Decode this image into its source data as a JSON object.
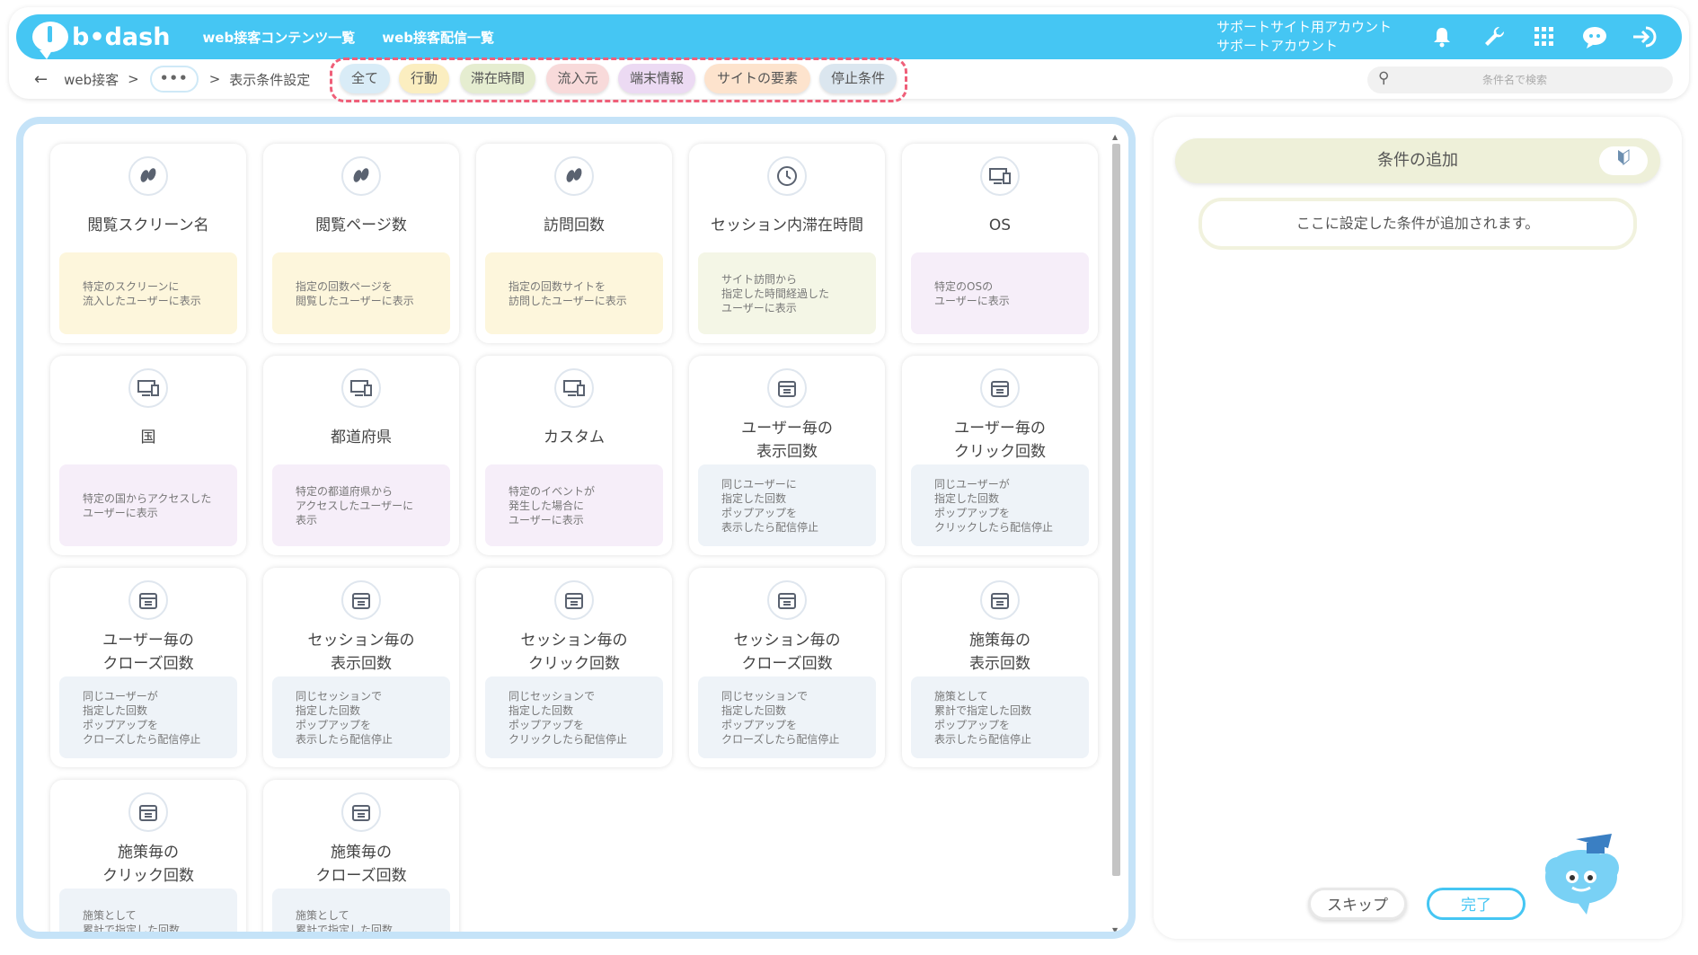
{
  "header": {
    "logo_text": "b•dash",
    "nav": [
      "web接客コンテンツ一覧",
      "web接客配信一覧"
    ],
    "account_line1": "サポートサイト用アカウント",
    "account_line2": "サポートアカウント",
    "icons": [
      "bell-icon",
      "wrench-icon",
      "grid-icon",
      "chat-bot-icon",
      "logout-icon"
    ]
  },
  "breadcrumb": {
    "back": "←",
    "item1": "web接客",
    "sep": ">",
    "dots": "•••",
    "sep2": ">",
    "current": "表示条件設定"
  },
  "tabs": [
    {
      "label": "全て",
      "color": "#d9ecf7"
    },
    {
      "label": "行動",
      "color": "#fbeec0"
    },
    {
      "label": "滞在時間",
      "color": "#e5edd0"
    },
    {
      "label": "流入元",
      "color": "#f8dada"
    },
    {
      "label": "端末情報",
      "color": "#ecdaf3"
    },
    {
      "label": "サイトの要素",
      "color": "#fde3cd"
    },
    {
      "label": "停止条件",
      "color": "#dbe6ef"
    }
  ],
  "search": {
    "placeholder": "条件名で検索"
  },
  "cards": [
    {
      "title": "閲覧スクリーン名",
      "desc": "特定のスクリーンに\n流入したユーザーに表示",
      "icon": "footprints-icon",
      "bg": "#fdf6dc"
    },
    {
      "title": "閲覧ページ数",
      "desc": "指定の回数ページを\n閲覧したユーザーに表示",
      "icon": "footprints-icon",
      "bg": "#fdf6dc"
    },
    {
      "title": "訪問回数",
      "desc": "指定の回数サイトを\n訪問したユーザーに表示",
      "icon": "footprints-icon",
      "bg": "#fdf6dc"
    },
    {
      "title": "セッション内滞在時間",
      "desc": "サイト訪問から\n指定した時間経過した\nユーザーに表示",
      "icon": "clock-icon",
      "bg": "#f4f6e6"
    },
    {
      "title": "OS",
      "desc": "特定のOSの\nユーザーに表示",
      "icon": "monitor-icon",
      "bg": "#f6eef9"
    },
    {
      "title": "国",
      "desc": "特定の国からアクセスした\nユーザーに表示",
      "icon": "monitor-icon",
      "bg": "#f6eef9"
    },
    {
      "title": "都道府県",
      "desc": "特定の都道府県から\nアクセスしたユーザーに\n表示",
      "icon": "monitor-icon",
      "bg": "#f6eef9"
    },
    {
      "title": "カスタム",
      "desc": "特定のイベントが\n発生した場合に\nユーザーに表示",
      "icon": "monitor-icon",
      "bg": "#f6eef9"
    },
    {
      "title": "ユーザー毎の\n表示回数",
      "desc": "同じユーザーに\n指定した回数\nポップアップを\n表示したら配信停止",
      "icon": "calendar-icon",
      "bg": "#eef3f8"
    },
    {
      "title": "ユーザー毎の\nクリック回数",
      "desc": "同じユーザーが\n指定した回数\nポップアップを\nクリックしたら配信停止",
      "icon": "calendar-icon",
      "bg": "#eef3f8"
    },
    {
      "title": "ユーザー毎の\nクローズ回数",
      "desc": "同じユーザーが\n指定した回数\nポップアップを\nクローズしたら配信停止",
      "icon": "calendar-icon",
      "bg": "#eef3f8"
    },
    {
      "title": "セッション毎の\n表示回数",
      "desc": "同じセッションで\n指定した回数\nポップアップを\n表示したら配信停止",
      "icon": "calendar-icon",
      "bg": "#eef3f8"
    },
    {
      "title": "セッション毎の\nクリック回数",
      "desc": "同じセッションで\n指定した回数\nポップアップを\nクリックしたら配信停止",
      "icon": "calendar-icon",
      "bg": "#eef3f8"
    },
    {
      "title": "セッション毎の\nクローズ回数",
      "desc": "同じセッションで\n指定した回数\nポップアップを\nクローズしたら配信停止",
      "icon": "calendar-icon",
      "bg": "#eef3f8"
    },
    {
      "title": "施策毎の\n表示回数",
      "desc": "施策として\n累計で指定した回数\nポップアップを\n表示したら配信停止",
      "icon": "calendar-icon",
      "bg": "#eef3f8"
    },
    {
      "title": "施策毎の\nクリック回数",
      "desc": "施策として\n累計で指定した回数\nポップアップを",
      "icon": "calendar-icon",
      "bg": "#eef3f8"
    },
    {
      "title": "施策毎の\nクローズ回数",
      "desc": "施策として\n累計で指定した回数\nポップアップを",
      "icon": "calendar-icon",
      "bg": "#eef3f8"
    }
  ],
  "panel": {
    "title": "条件の追加",
    "placeholder": "ここに設定した条件が追加されます。",
    "skip": "スキップ",
    "done": "完了"
  }
}
